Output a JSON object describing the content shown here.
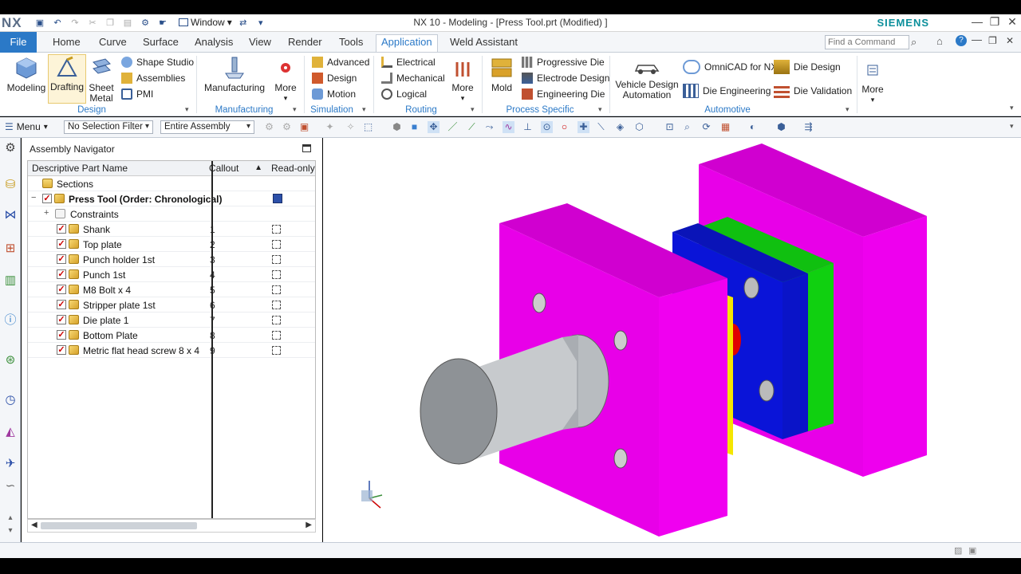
{
  "titlebar": {
    "app": "NX",
    "title": "NX 10 - Modeling - [Press Tool.prt (Modified) ]",
    "brand": "SIEMENS",
    "window_menu": "Window"
  },
  "tabs": {
    "file": "File",
    "items": [
      "Home",
      "Curve",
      "Surface",
      "Analysis",
      "View",
      "Render",
      "Tools",
      "Application",
      "Weld Assistant"
    ],
    "active": "Application"
  },
  "search": {
    "placeholder": "Find a Command"
  },
  "ribbon": {
    "modeling": "Modeling",
    "drafting": "Drafting",
    "sheet_metal": "Sheet\nMetal",
    "shape_studio": "Shape Studio",
    "assemblies": "Assemblies",
    "pmi": "PMI",
    "manufacturing": "Manufacturing",
    "more": "More",
    "advanced": "Advanced",
    "design": "Design",
    "motion": "Motion",
    "electrical": "Electrical",
    "mechanical": "Mechanical",
    "logical": "Logical",
    "mold": "Mold",
    "progressive_die": "Progressive Die",
    "electrode_design": "Electrode Design",
    "engineering_die": "Engineering Die",
    "vehicle_design": "Vehicle Design\nAutomation",
    "omnicad": "OmniCAD for NX",
    "die_engineering": "Die Engineering",
    "die_design": "Die Design",
    "die_validation": "Die Validation",
    "groups": {
      "design": "Design",
      "manufacturing": "Manufacturing",
      "simulation": "Simulation",
      "routing": "Routing",
      "process_specific": "Process Specific",
      "automotive": "Automotive"
    }
  },
  "toolbar": {
    "menu": "Menu",
    "selection_filter": "No Selection Filter",
    "assembly_scope": "Entire Assembly"
  },
  "navigator": {
    "title": "Assembly Navigator",
    "columns": {
      "name": "Descriptive Part Name",
      "callout": "Callout",
      "readonly": "Read-only"
    },
    "sections": "Sections",
    "root": "Press Tool (Order: Chronological)",
    "constraints": "Constraints",
    "parts": [
      {
        "name": "Shank",
        "callout": "1"
      },
      {
        "name": "Top plate",
        "callout": "2"
      },
      {
        "name": "Punch holder 1st",
        "callout": "3"
      },
      {
        "name": "Punch 1st",
        "callout": "4"
      },
      {
        "name": "M8 Bolt x 4",
        "callout": "5"
      },
      {
        "name": "Stripper plate 1st",
        "callout": "6"
      },
      {
        "name": "Die plate 1",
        "callout": "7"
      },
      {
        "name": "Bottom Plate",
        "callout": "8"
      },
      {
        "name": "Metric flat head screw 8 x 4",
        "callout": "9"
      }
    ]
  },
  "colors": {
    "accent": "#2b79c7",
    "magenta": "#f000f0",
    "blue": "#0a14d8",
    "green": "#10e010",
    "yellow": "#f5e600",
    "red": "#e00000"
  },
  "icons": [
    "save-icon",
    "undo-icon",
    "redo-icon",
    "help-icon",
    "search-icon",
    "close-icon",
    "minimize-icon",
    "restore-icon"
  ]
}
